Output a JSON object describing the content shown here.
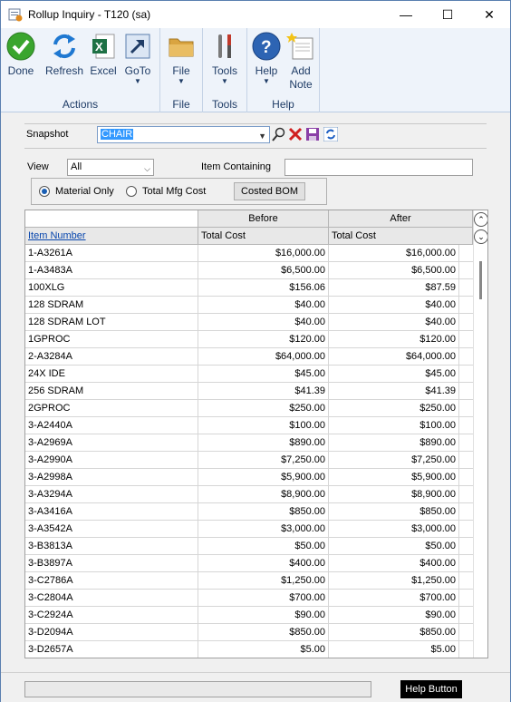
{
  "window": {
    "title": "Rollup Inquiry  -  T120 (sa)",
    "minimize": "—",
    "maximize": "☐",
    "close": "✕"
  },
  "ribbon": {
    "groups": [
      {
        "label": "Actions",
        "buttons": [
          {
            "label": "Done"
          },
          {
            "label": "Refresh"
          },
          {
            "label": "Excel"
          },
          {
            "label": "GoTo"
          }
        ]
      },
      {
        "label": "File",
        "buttons": [
          {
            "label": "File"
          }
        ]
      },
      {
        "label": "Tools",
        "buttons": [
          {
            "label": "Tools"
          }
        ]
      },
      {
        "label": "Help",
        "buttons": [
          {
            "label": "Help"
          },
          {
            "label": "Add Note"
          }
        ]
      }
    ]
  },
  "snapshot": {
    "label": "Snapshot",
    "value": "CHAIR"
  },
  "view": {
    "label": "View",
    "value": "All"
  },
  "item_containing": {
    "label": "Item Containing",
    "value": ""
  },
  "options": {
    "material_only": "Material Only",
    "total_mfg_cost": "Total Mfg Cost",
    "costed_bom": "Costed BOM"
  },
  "grid": {
    "header_before": "Before",
    "header_after": "After",
    "col_item": "Item Number",
    "col_before_cost": "Total Cost",
    "col_after_cost": "Total Cost",
    "rows": [
      {
        "item": "1-A3261A",
        "before": "$16,000.00",
        "after": "$16,000.00"
      },
      {
        "item": "1-A3483A",
        "before": "$6,500.00",
        "after": "$6,500.00"
      },
      {
        "item": "100XLG",
        "before": "$156.06",
        "after": "$87.59"
      },
      {
        "item": "128 SDRAM",
        "before": "$40.00",
        "after": "$40.00"
      },
      {
        "item": "128 SDRAM LOT",
        "before": "$40.00",
        "after": "$40.00"
      },
      {
        "item": "1GPROC",
        "before": "$120.00",
        "after": "$120.00"
      },
      {
        "item": "2-A3284A",
        "before": "$64,000.00",
        "after": "$64,000.00"
      },
      {
        "item": "24X IDE",
        "before": "$45.00",
        "after": "$45.00"
      },
      {
        "item": "256 SDRAM",
        "before": "$41.39",
        "after": "$41.39"
      },
      {
        "item": "2GPROC",
        "before": "$250.00",
        "after": "$250.00"
      },
      {
        "item": "3-A2440A",
        "before": "$100.00",
        "after": "$100.00"
      },
      {
        "item": "3-A2969A",
        "before": "$890.00",
        "after": "$890.00"
      },
      {
        "item": "3-A2990A",
        "before": "$7,250.00",
        "after": "$7,250.00"
      },
      {
        "item": "3-A2998A",
        "before": "$5,900.00",
        "after": "$5,900.00"
      },
      {
        "item": "3-A3294A",
        "before": "$8,900.00",
        "after": "$8,900.00"
      },
      {
        "item": "3-A3416A",
        "before": "$850.00",
        "after": "$850.00"
      },
      {
        "item": "3-A3542A",
        "before": "$3,000.00",
        "after": "$3,000.00"
      },
      {
        "item": "3-B3813A",
        "before": "$50.00",
        "after": "$50.00"
      },
      {
        "item": "3-B3897A",
        "before": "$400.00",
        "after": "$400.00"
      },
      {
        "item": "3-C2786A",
        "before": "$1,250.00",
        "after": "$1,250.00"
      },
      {
        "item": "3-C2804A",
        "before": "$700.00",
        "after": "$700.00"
      },
      {
        "item": "3-C2924A",
        "before": "$90.00",
        "after": "$90.00"
      },
      {
        "item": "3-D2094A",
        "before": "$850.00",
        "after": "$850.00"
      },
      {
        "item": "3-D2657A",
        "before": "$5.00",
        "after": "$5.00"
      }
    ]
  },
  "status": {
    "help_button": "Help Button"
  }
}
